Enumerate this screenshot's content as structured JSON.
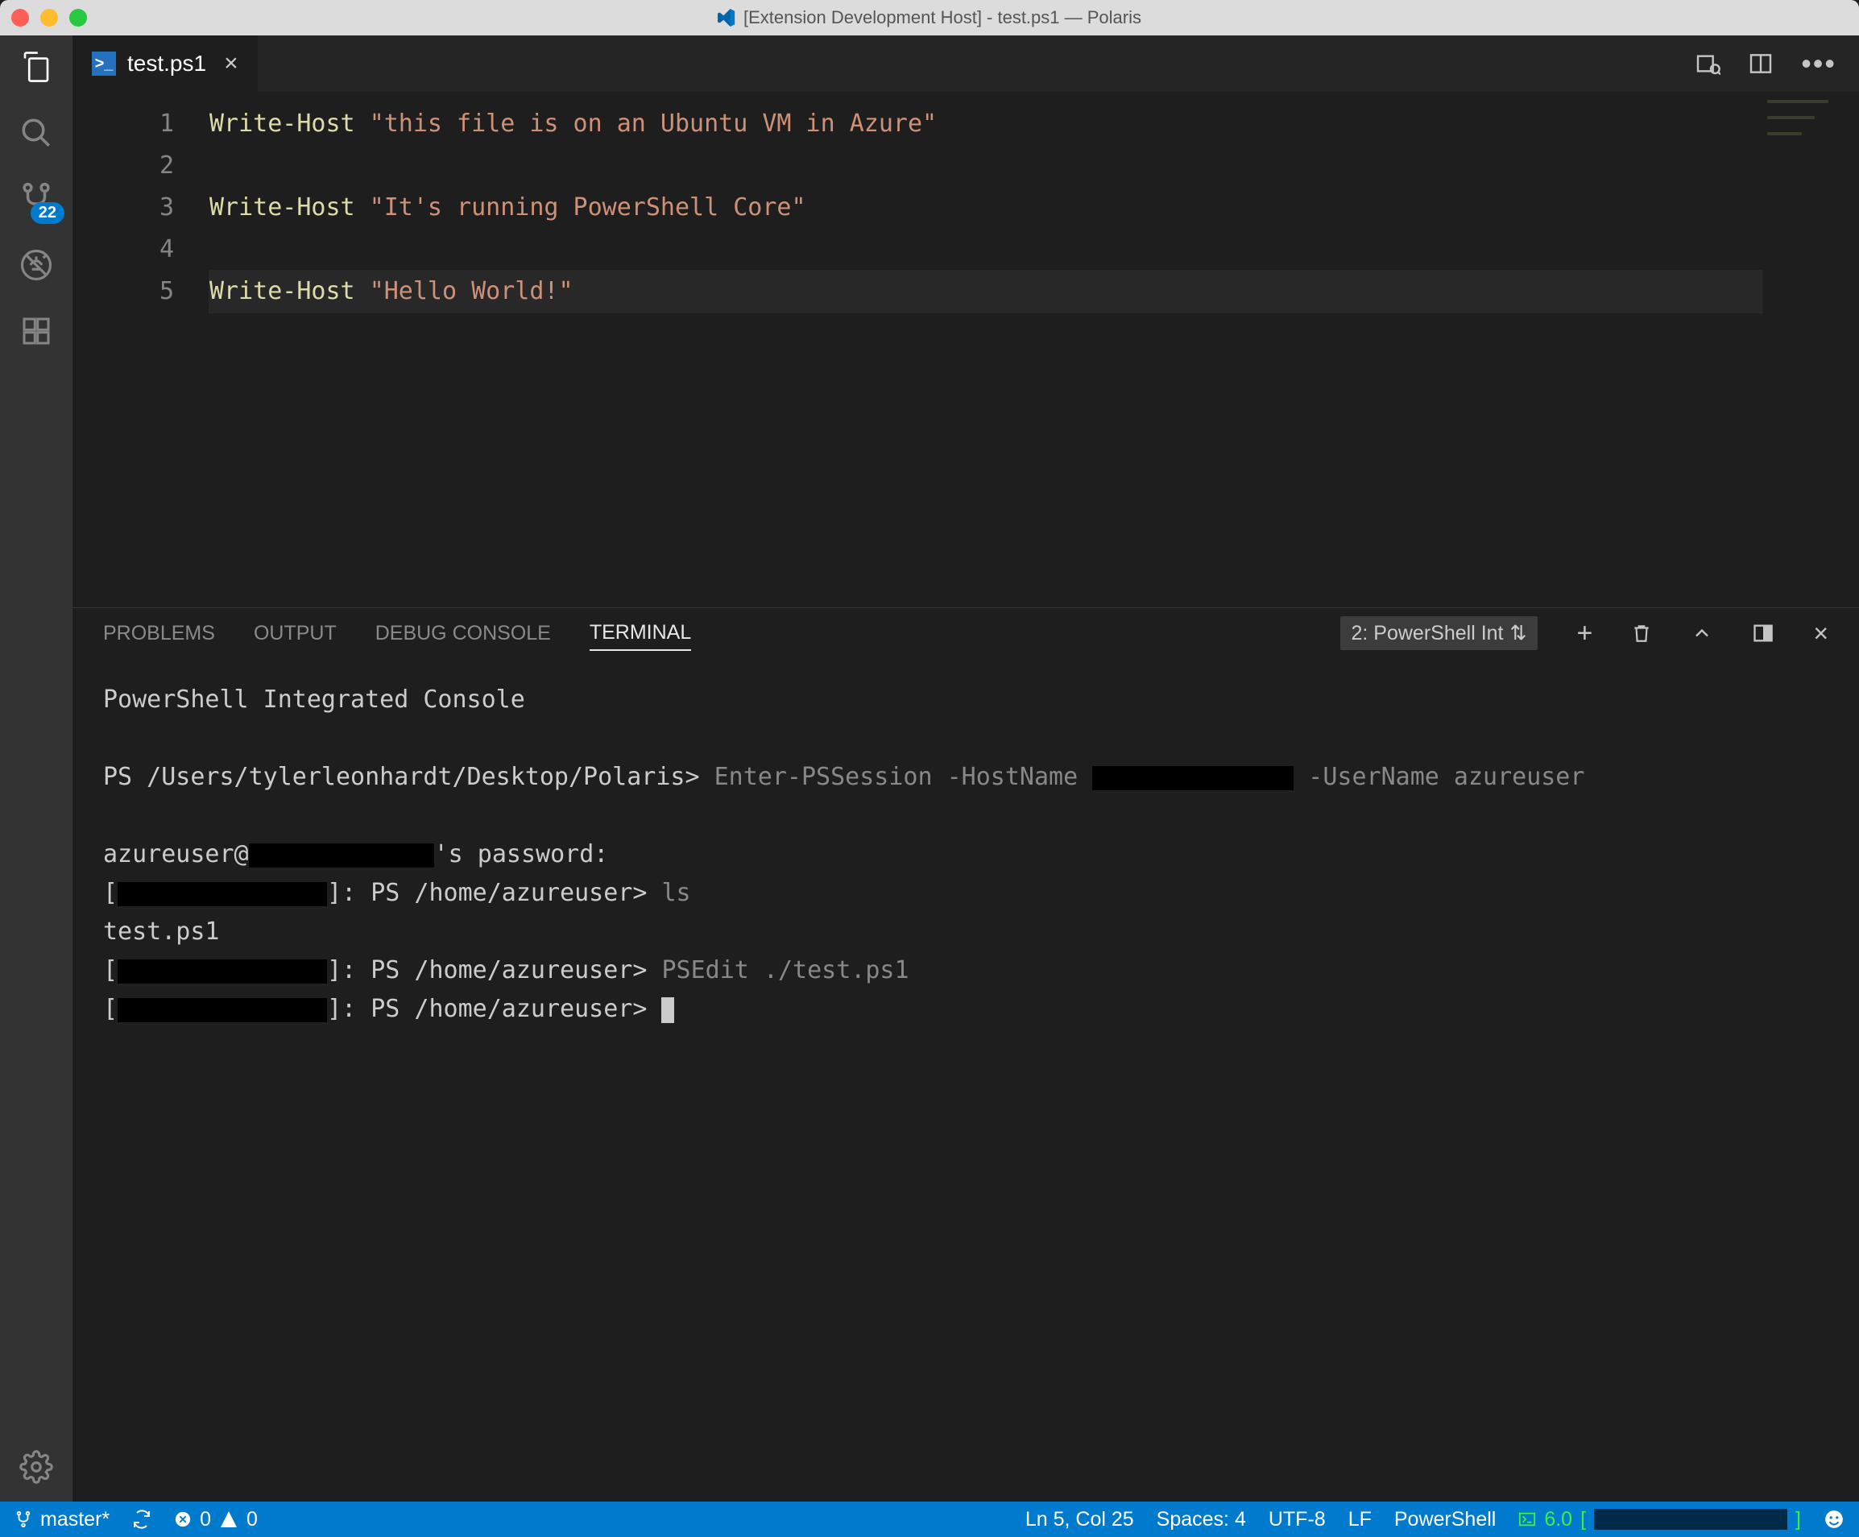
{
  "window": {
    "title": "[Extension Development Host] - test.ps1 — Polaris"
  },
  "activity": {
    "scm_badge": "22"
  },
  "tabs": {
    "file": "test.ps1"
  },
  "editor": {
    "line_numbers": [
      "1",
      "2",
      "3",
      "4",
      "5"
    ],
    "l1_cmd": "Write-Host ",
    "l1_str": "\"this file is on an Ubuntu VM in Azure\"",
    "l3_cmd": "Write-Host ",
    "l3_str": "\"It's running PowerShell Core\"",
    "l5_cmd": "Write-Host ",
    "l5_str": "\"Hello World!\""
  },
  "panel": {
    "tabs": {
      "problems": "PROBLEMS",
      "output": "OUTPUT",
      "debug": "DEBUG CONSOLE",
      "terminal": "TERMINAL"
    },
    "selector": "2: PowerShell Int",
    "terminal": {
      "header": "PowerShell Integrated Console",
      "prompt1_a": "PS /Users/tylerleonhardt/Desktop/Polaris>",
      "prompt1_b": " Enter-PSSession -HostName ",
      "prompt1_c": " -UserName azureuser",
      "pwline_a": "azureuser@",
      "pwline_b": "'s password:",
      "r1_bracket_open": "[",
      "r1_bracket_close": "]: PS /home/azureuser> ",
      "r1_cmd": "ls",
      "ls_out": "test.ps1",
      "r2_cmd": "PSEdit ./test.ps1",
      "r3_cmd": ""
    }
  },
  "status": {
    "branch": "master*",
    "err": "0",
    "warn": "0",
    "ln": "Ln 5, Col 25",
    "spaces": "Spaces: 4",
    "enc": "UTF-8",
    "eol": "LF",
    "lang": "PowerShell",
    "ps": "6.0",
    "ps_open": "[",
    "ps_close": "]"
  }
}
